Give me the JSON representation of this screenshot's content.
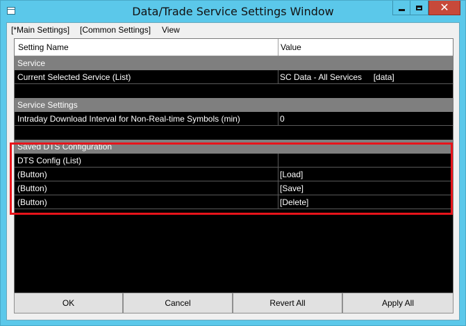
{
  "window": {
    "title": "Data/Trade Service Settings Window"
  },
  "menu": [
    "[*Main Settings]",
    "[Common Settings]",
    "View"
  ],
  "columns": {
    "name": "Setting Name",
    "value": "Value"
  },
  "rows": [
    {
      "kind": "section",
      "name": "Service",
      "value": ""
    },
    {
      "kind": "data",
      "name": "Current Selected Service (List)",
      "value": "SC Data - All Services     [data]"
    },
    {
      "kind": "blank",
      "name": "",
      "value": ""
    },
    {
      "kind": "section",
      "name": "Service Settings",
      "value": ""
    },
    {
      "kind": "data",
      "name": "Intraday Download Interval for Non-Real-time Symbols (min)",
      "value": "0"
    },
    {
      "kind": "blank",
      "name": "",
      "value": ""
    },
    {
      "kind": "section",
      "name": "Saved DTS Configuration",
      "value": ""
    },
    {
      "kind": "data",
      "name": "DTS Config (List)",
      "value": ""
    },
    {
      "kind": "data",
      "name": "(Button)",
      "value": "[Load]"
    },
    {
      "kind": "data",
      "name": "(Button)",
      "value": "[Save]"
    },
    {
      "kind": "data",
      "name": "(Button)",
      "value": "[Delete]"
    }
  ],
  "buttons": {
    "ok": "OK",
    "cancel": "Cancel",
    "revert": "Revert All",
    "apply": "Apply All"
  },
  "colors": {
    "titlebar": "#5bc8ea",
    "close": "#c7493a",
    "section": "#7f7f7f",
    "grid": "#000000",
    "highlight": "#e8141b"
  }
}
